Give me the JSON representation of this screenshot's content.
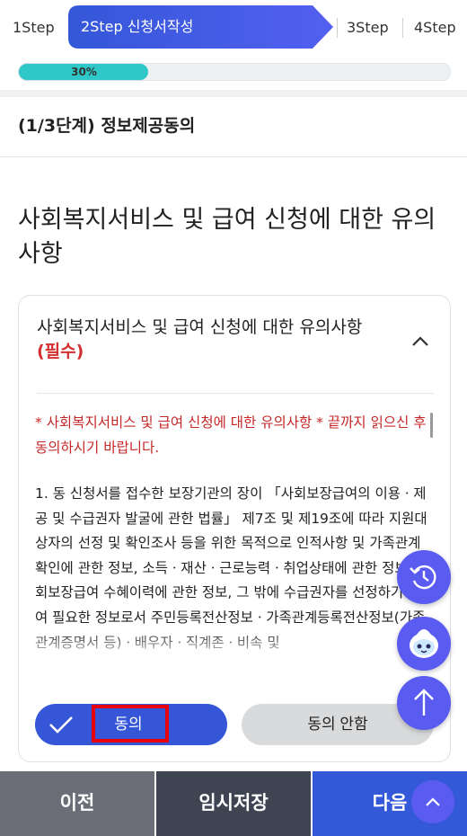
{
  "steps": [
    {
      "label": "1Step"
    },
    {
      "label": "2Step 신청서작성"
    },
    {
      "label": "3Step"
    },
    {
      "label": "4Step"
    }
  ],
  "progress": {
    "percent": 30,
    "text": "30%"
  },
  "stage_title": "(1/3단계) 정보제공동의",
  "main_title": "사회복지서비스 및 급여 신청에 대한 유의사항",
  "card": {
    "heading": "사회복지서비스 및 급여 신청에 대한 유의사항",
    "required": "(필수)",
    "notice": "* 사회복지서비스 및 급여 신청에 대한 유의사항 * 끝까지 읽으신 후 동의하시기 바랍니다.",
    "body": "1. 동 신청서를 접수한 보장기관의 장이 「사회보장급여의 이용ㆍ제공 및 수급권자 발굴에 관한 법률」 제7조 및 제19조에 따라 지원대상자의 선정 및 확인조사 등을 위한 목적으로 인적사항 및 가족관계 확인에 관한 정보, 소득ㆍ재산ㆍ근로능력ㆍ취업상태에 관한 정보, 사회보장급여 수혜이력에 관한 정보, 그 밖에 수급권자를 선정하기 위하여 필요한 정보로서 주민등록전산정보ㆍ가족관계등록전산정보(가족관계증명서 등)ㆍ배우자ㆍ직계존ㆍ비속 및",
    "agree_label": "동의",
    "disagree_label": "동의 안함"
  },
  "bottom": {
    "prev_label": "이전",
    "save_label": "임시저장",
    "next_label": "다음"
  },
  "colors": {
    "accent": "#3556d6",
    "progress": "#2ec8c8",
    "required": "#d32f2f",
    "highlight_box": "#e8000d"
  }
}
